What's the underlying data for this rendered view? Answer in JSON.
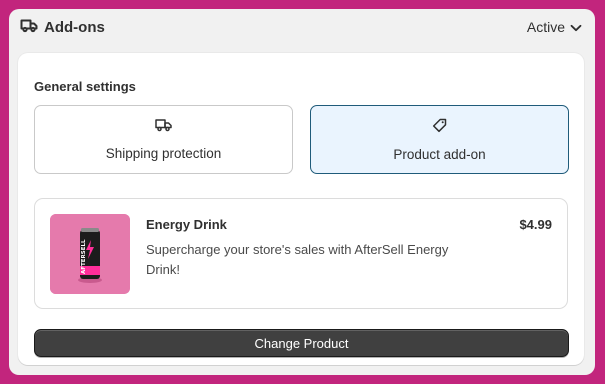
{
  "header": {
    "icon": "truck-icon",
    "title": "Add-ons",
    "status": "Active",
    "status_icon": "chevron-down-icon"
  },
  "general": {
    "title": "General settings",
    "options": [
      {
        "label": "Shipping protection",
        "icon": "truck-icon",
        "selected": false
      },
      {
        "label": "Product add-on",
        "icon": "tag-icon",
        "selected": true
      }
    ]
  },
  "product": {
    "name": "Energy Drink",
    "price": "$4.99",
    "description": "Supercharge your store's sales with AfterSell Energy Drink!",
    "image_text": "AFTERSELL",
    "image_colors": {
      "background": "#e57aac",
      "can": "#1c1c1c",
      "accent": "#ff2e9a"
    }
  },
  "actions": {
    "change_label": "Change Product"
  },
  "colors": {
    "page_background": "#c2257d",
    "selected_background": "#eaf4fe",
    "selected_border": "#1f5b7a",
    "button_background": "#404040"
  }
}
